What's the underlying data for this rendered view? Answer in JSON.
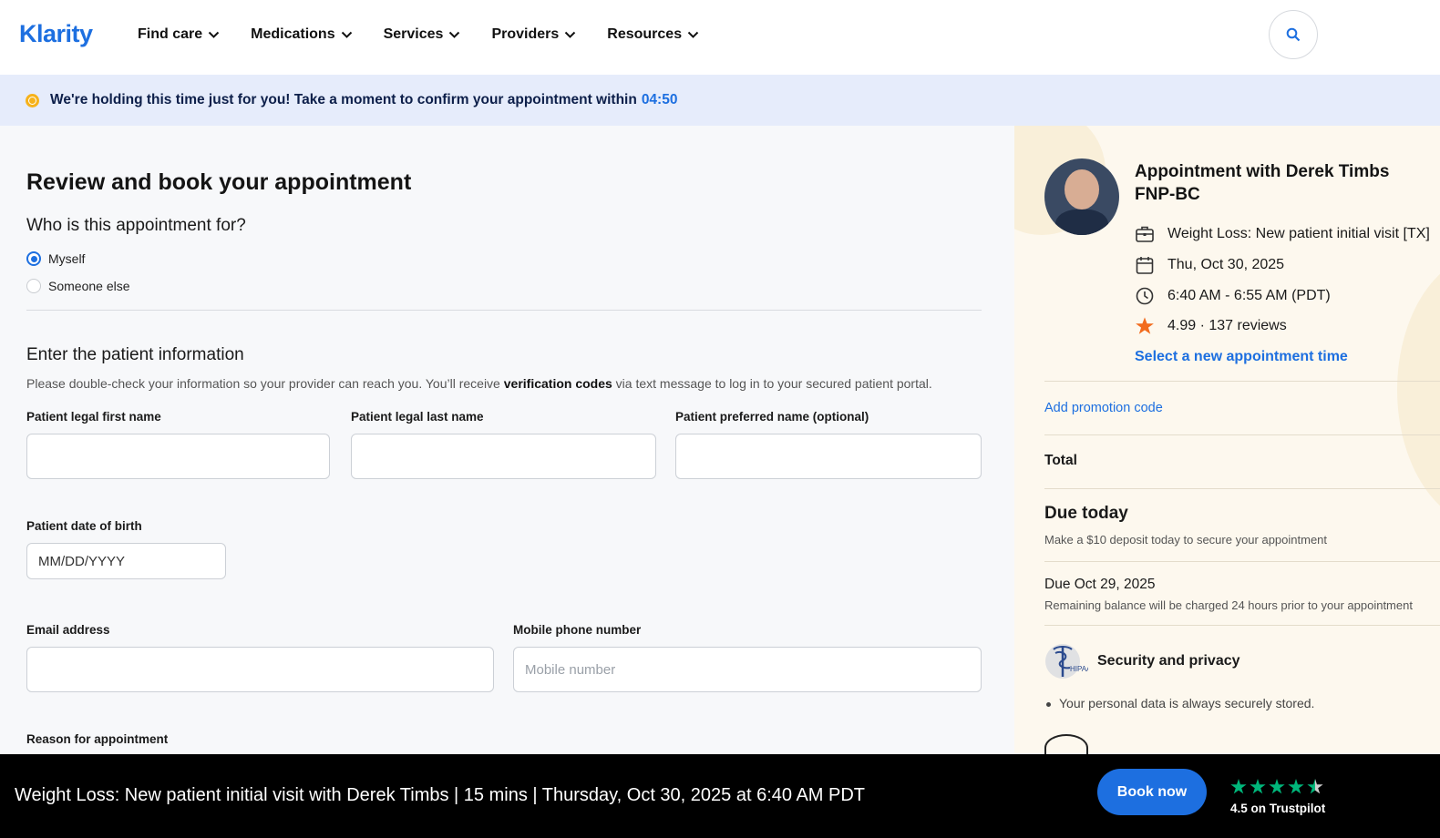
{
  "header": {
    "logo": "Klarity",
    "nav": [
      {
        "label": "Find care"
      },
      {
        "label": "Medications"
      },
      {
        "label": "Services"
      },
      {
        "label": "Providers"
      },
      {
        "label": "Resources"
      }
    ],
    "search_icon": "search-icon"
  },
  "banner": {
    "text": "We're holding this time just for you! Take a moment to confirm your appointment within",
    "timer": "04:50"
  },
  "form": {
    "title": "Review and book your appointment",
    "who_question": "Who is this appointment for?",
    "options": [
      {
        "label": "Myself",
        "selected": true
      },
      {
        "label": "Someone else",
        "selected": false
      }
    ],
    "patient_section_title": "Enter the patient information",
    "helper_before": "Please double-check your information so your provider can reach you. You’ll receive ",
    "helper_bold": "verification codes",
    "helper_after": " via text message to log in to your secured patient portal.",
    "first_name_label": "Patient legal first name",
    "first_name_value": "",
    "last_name_label": "Patient legal last name",
    "last_name_value": "",
    "preferred_name_label": "Patient preferred name (optional)",
    "preferred_name_value": "",
    "dob_label": "Patient date of birth",
    "dob_placeholder": "MM/DD/YYYY",
    "email_label": "Email address",
    "email_value": "",
    "phone_label": "Mobile phone number",
    "phone_placeholder": "Mobile number",
    "reason_label": "Reason for appointment"
  },
  "summary": {
    "title": "Appointment with Derek Timbs FNP-BC",
    "visit_type": "Weight Loss: New patient initial visit [TX]",
    "date": "Thu, Oct 30, 2025",
    "time": "6:40 AM - 6:55 AM (PDT)",
    "rating": "4.99 · 137 reviews",
    "select_new_time": "Select a new appointment time",
    "promo_link": "Add promotion code",
    "total_label": "Total",
    "due_today_label": "Due today",
    "due_today_note": "Make a $10 deposit today to secure your appointment",
    "due_date_label": "Due Oct 29, 2025",
    "due_date_note": "Remaining balance will be charged 24 hours prior to your appointment",
    "security_title": "Security and privacy",
    "security_bullet": "Your personal data is always securely stored.",
    "hipaa_badge_text": "HIPAA",
    "accent_color": "#1d6fe0",
    "star_color": "#f26b1d"
  },
  "bottom_bar": {
    "summary_text": "Weight Loss: New patient initial visit with Derek Timbs | 15 mins | Thursday, Oct 30, 2025 at 6:40 AM PDT",
    "book_button": "Book now",
    "trustpilot_rating": 4.5,
    "trustpilot_text": "4.5 on Trustpilot",
    "trustpilot_color": "#00b67a"
  }
}
